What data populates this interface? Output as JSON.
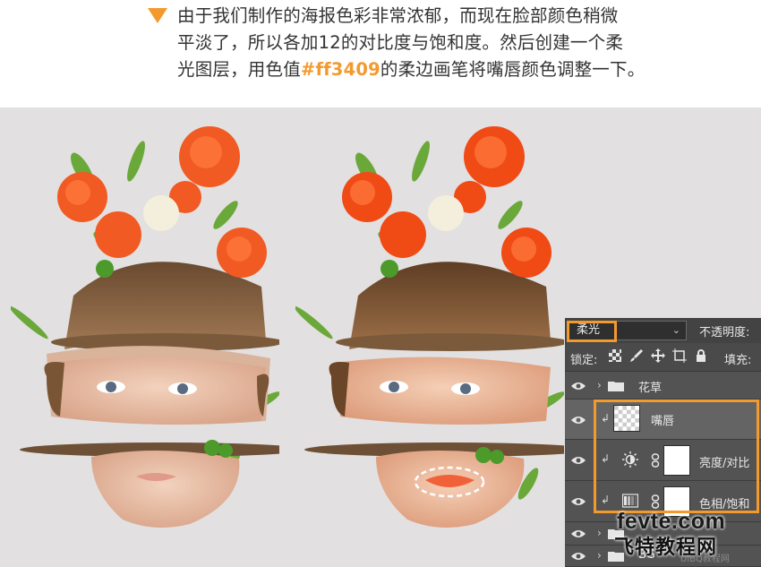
{
  "instruction": {
    "line1": "由于我们制作的海报色彩非常浓郁，而现在脸部颜色稍微",
    "line2": "平淡了，所以各加12的对比度与饱和度。然后创建一个柔",
    "line3_before": "光图层，用色值",
    "line3_hex": "#ff3409",
    "line3_after": "的柔边画笔将嘴唇颜色调整一下。",
    "accent_color": "#f39a2e"
  },
  "layers_panel": {
    "blend_mode": "柔光",
    "opacity_label": "不透明度:",
    "lock_label": "锁定:",
    "fill_label": "填充:",
    "layers": [
      {
        "name": "花草",
        "kind": "group",
        "icon": "folder-icon",
        "visible": true
      },
      {
        "name": "嘴唇",
        "kind": "pixel",
        "clipped": true,
        "selected": true,
        "visible": true
      },
      {
        "name": "亮度/对比",
        "kind": "adjustment",
        "icon": "brightness-contrast-icon",
        "clipped": true,
        "visible": true
      },
      {
        "name": "色相/饱和",
        "kind": "adjustment",
        "icon": "hue-saturation-icon",
        "clipped": true,
        "visible": true
      },
      {
        "name": "",
        "kind": "group",
        "icon": "folder-icon",
        "visible": true
      },
      {
        "name": "BG",
        "kind": "group",
        "icon": "folder-icon",
        "visible": true
      }
    ]
  },
  "watermark": {
    "main": "fevte.com",
    "sub": "飞特教程网",
    "faint": "UiBQ教程网"
  }
}
